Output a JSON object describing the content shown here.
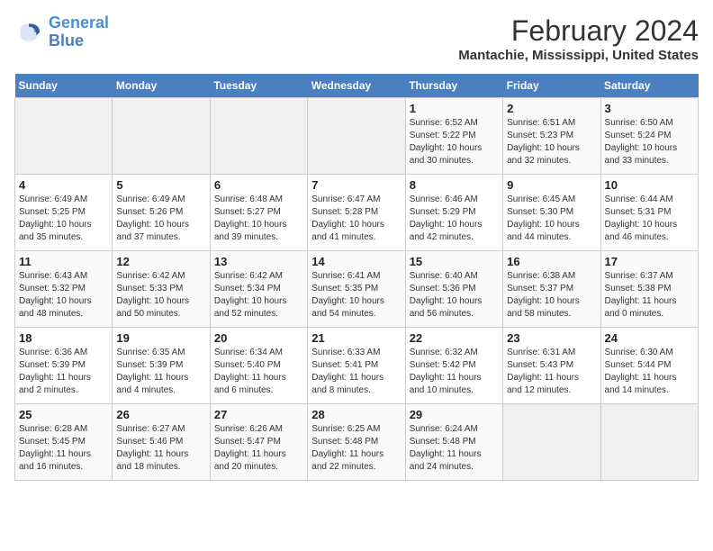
{
  "header": {
    "logo_line1": "General",
    "logo_line2": "Blue",
    "title": "February 2024",
    "subtitle": "Mantachie, Mississippi, United States"
  },
  "days_of_week": [
    "Sunday",
    "Monday",
    "Tuesday",
    "Wednesday",
    "Thursday",
    "Friday",
    "Saturday"
  ],
  "weeks": [
    [
      {
        "day": "",
        "info": ""
      },
      {
        "day": "",
        "info": ""
      },
      {
        "day": "",
        "info": ""
      },
      {
        "day": "",
        "info": ""
      },
      {
        "day": "1",
        "info": "Sunrise: 6:52 AM\nSunset: 5:22 PM\nDaylight: 10 hours\nand 30 minutes."
      },
      {
        "day": "2",
        "info": "Sunrise: 6:51 AM\nSunset: 5:23 PM\nDaylight: 10 hours\nand 32 minutes."
      },
      {
        "day": "3",
        "info": "Sunrise: 6:50 AM\nSunset: 5:24 PM\nDaylight: 10 hours\nand 33 minutes."
      }
    ],
    [
      {
        "day": "4",
        "info": "Sunrise: 6:49 AM\nSunset: 5:25 PM\nDaylight: 10 hours\nand 35 minutes."
      },
      {
        "day": "5",
        "info": "Sunrise: 6:49 AM\nSunset: 5:26 PM\nDaylight: 10 hours\nand 37 minutes."
      },
      {
        "day": "6",
        "info": "Sunrise: 6:48 AM\nSunset: 5:27 PM\nDaylight: 10 hours\nand 39 minutes."
      },
      {
        "day": "7",
        "info": "Sunrise: 6:47 AM\nSunset: 5:28 PM\nDaylight: 10 hours\nand 41 minutes."
      },
      {
        "day": "8",
        "info": "Sunrise: 6:46 AM\nSunset: 5:29 PM\nDaylight: 10 hours\nand 42 minutes."
      },
      {
        "day": "9",
        "info": "Sunrise: 6:45 AM\nSunset: 5:30 PM\nDaylight: 10 hours\nand 44 minutes."
      },
      {
        "day": "10",
        "info": "Sunrise: 6:44 AM\nSunset: 5:31 PM\nDaylight: 10 hours\nand 46 minutes."
      }
    ],
    [
      {
        "day": "11",
        "info": "Sunrise: 6:43 AM\nSunset: 5:32 PM\nDaylight: 10 hours\nand 48 minutes."
      },
      {
        "day": "12",
        "info": "Sunrise: 6:42 AM\nSunset: 5:33 PM\nDaylight: 10 hours\nand 50 minutes."
      },
      {
        "day": "13",
        "info": "Sunrise: 6:42 AM\nSunset: 5:34 PM\nDaylight: 10 hours\nand 52 minutes."
      },
      {
        "day": "14",
        "info": "Sunrise: 6:41 AM\nSunset: 5:35 PM\nDaylight: 10 hours\nand 54 minutes."
      },
      {
        "day": "15",
        "info": "Sunrise: 6:40 AM\nSunset: 5:36 PM\nDaylight: 10 hours\nand 56 minutes."
      },
      {
        "day": "16",
        "info": "Sunrise: 6:38 AM\nSunset: 5:37 PM\nDaylight: 10 hours\nand 58 minutes."
      },
      {
        "day": "17",
        "info": "Sunrise: 6:37 AM\nSunset: 5:38 PM\nDaylight: 11 hours\nand 0 minutes."
      }
    ],
    [
      {
        "day": "18",
        "info": "Sunrise: 6:36 AM\nSunset: 5:39 PM\nDaylight: 11 hours\nand 2 minutes."
      },
      {
        "day": "19",
        "info": "Sunrise: 6:35 AM\nSunset: 5:39 PM\nDaylight: 11 hours\nand 4 minutes."
      },
      {
        "day": "20",
        "info": "Sunrise: 6:34 AM\nSunset: 5:40 PM\nDaylight: 11 hours\nand 6 minutes."
      },
      {
        "day": "21",
        "info": "Sunrise: 6:33 AM\nSunset: 5:41 PM\nDaylight: 11 hours\nand 8 minutes."
      },
      {
        "day": "22",
        "info": "Sunrise: 6:32 AM\nSunset: 5:42 PM\nDaylight: 11 hours\nand 10 minutes."
      },
      {
        "day": "23",
        "info": "Sunrise: 6:31 AM\nSunset: 5:43 PM\nDaylight: 11 hours\nand 12 minutes."
      },
      {
        "day": "24",
        "info": "Sunrise: 6:30 AM\nSunset: 5:44 PM\nDaylight: 11 hours\nand 14 minutes."
      }
    ],
    [
      {
        "day": "25",
        "info": "Sunrise: 6:28 AM\nSunset: 5:45 PM\nDaylight: 11 hours\nand 16 minutes."
      },
      {
        "day": "26",
        "info": "Sunrise: 6:27 AM\nSunset: 5:46 PM\nDaylight: 11 hours\nand 18 minutes."
      },
      {
        "day": "27",
        "info": "Sunrise: 6:26 AM\nSunset: 5:47 PM\nDaylight: 11 hours\nand 20 minutes."
      },
      {
        "day": "28",
        "info": "Sunrise: 6:25 AM\nSunset: 5:48 PM\nDaylight: 11 hours\nand 22 minutes."
      },
      {
        "day": "29",
        "info": "Sunrise: 6:24 AM\nSunset: 5:48 PM\nDaylight: 11 hours\nand 24 minutes."
      },
      {
        "day": "",
        "info": ""
      },
      {
        "day": "",
        "info": ""
      }
    ]
  ]
}
